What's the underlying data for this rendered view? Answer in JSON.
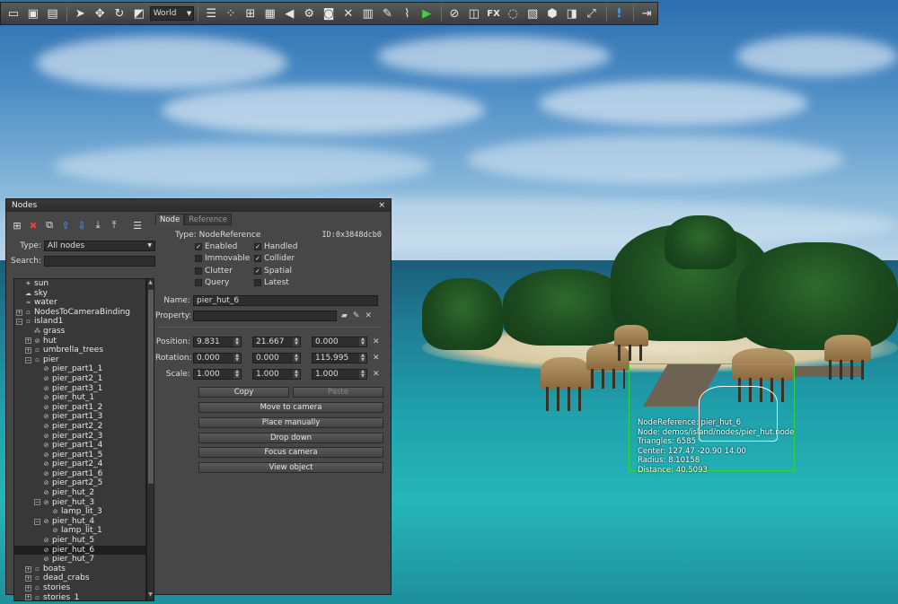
{
  "toolbar": {
    "coord_space": "World",
    "fx_label": "FX",
    "icons": [
      "new-icon",
      "open-icon",
      "save-icon",
      "pointer-icon",
      "move-icon",
      "rotate-icon",
      "scale-icon",
      "nodes-list-icon",
      "materials-icon",
      "grid-icon",
      "render-icon",
      "sound-icon",
      "physics-icon",
      "camera-icon",
      "tools-icon",
      "editor-icon",
      "script-icon",
      "profiler-icon",
      "play-icon",
      "link-icon",
      "node-icon",
      "light-icon",
      "texture-icon",
      "mesh-icon",
      "world-icon",
      "expand-icon",
      "warning-icon",
      "exit-icon"
    ]
  },
  "nodes_window": {
    "title": "Nodes",
    "close": "×",
    "type_label": "Type:",
    "type_value": "All nodes",
    "search_label": "Search:",
    "search_value": "",
    "tree": [
      {
        "label": "sun",
        "indent": 0,
        "expander": "",
        "icon": "sun-icon"
      },
      {
        "label": "sky",
        "indent": 0,
        "expander": "",
        "icon": "sky-icon"
      },
      {
        "label": "water",
        "indent": 0,
        "expander": "",
        "icon": "water-icon"
      },
      {
        "label": "NodesToCameraBinding",
        "indent": 0,
        "expander": "+",
        "icon": "node-icon"
      },
      {
        "label": "island1",
        "indent": 0,
        "expander": "−",
        "icon": "node-icon"
      },
      {
        "label": "grass",
        "indent": 1,
        "expander": "",
        "icon": "grass-icon"
      },
      {
        "label": "hut",
        "indent": 1,
        "expander": "+",
        "icon": "reference-icon"
      },
      {
        "label": "umbrella_trees",
        "indent": 1,
        "expander": "+",
        "icon": "node-icon"
      },
      {
        "label": "pier",
        "indent": 1,
        "expander": "−",
        "icon": "node-icon"
      },
      {
        "label": "pier_part1_1",
        "indent": 2,
        "expander": "",
        "icon": "reference-icon"
      },
      {
        "label": "pier_part2_1",
        "indent": 2,
        "expander": "",
        "icon": "reference-icon"
      },
      {
        "label": "pier_part3_1",
        "indent": 2,
        "expander": "",
        "icon": "reference-icon"
      },
      {
        "label": "pier_hut_1",
        "indent": 2,
        "expander": "",
        "icon": "reference-icon"
      },
      {
        "label": "pier_part1_2",
        "indent": 2,
        "expander": "",
        "icon": "reference-icon"
      },
      {
        "label": "pier_part1_3",
        "indent": 2,
        "expander": "",
        "icon": "reference-icon"
      },
      {
        "label": "pier_part2_2",
        "indent": 2,
        "expander": "",
        "icon": "reference-icon"
      },
      {
        "label": "pier_part2_3",
        "indent": 2,
        "expander": "",
        "icon": "reference-icon"
      },
      {
        "label": "pier_part1_4",
        "indent": 2,
        "expander": "",
        "icon": "reference-icon"
      },
      {
        "label": "pier_part1_5",
        "indent": 2,
        "expander": "",
        "icon": "reference-icon"
      },
      {
        "label": "pier_part2_4",
        "indent": 2,
        "expander": "",
        "icon": "reference-icon"
      },
      {
        "label": "pier_part1_6",
        "indent": 2,
        "expander": "",
        "icon": "reference-icon"
      },
      {
        "label": "pier_part2_5",
        "indent": 2,
        "expander": "",
        "icon": "reference-icon"
      },
      {
        "label": "pier_hut_2",
        "indent": 2,
        "expander": "",
        "icon": "reference-icon"
      },
      {
        "label": "pier_hut_3",
        "indent": 2,
        "expander": "−",
        "icon": "reference-icon"
      },
      {
        "label": "lamp_lit_3",
        "indent": 3,
        "expander": "",
        "icon": "reference-icon"
      },
      {
        "label": "pier_hut_4",
        "indent": 2,
        "expander": "−",
        "icon": "reference-icon"
      },
      {
        "label": "lamp_lit_1",
        "indent": 3,
        "expander": "",
        "icon": "reference-icon"
      },
      {
        "label": "pier_hut_5",
        "indent": 2,
        "expander": "",
        "icon": "reference-icon"
      },
      {
        "label": "pier_hut_6",
        "indent": 2,
        "expander": "",
        "icon": "reference-icon",
        "selected": true
      },
      {
        "label": "pier_hut_7",
        "indent": 2,
        "expander": "",
        "icon": "reference-icon"
      },
      {
        "label": "boats",
        "indent": 1,
        "expander": "+",
        "icon": "node-icon"
      },
      {
        "label": "dead_crabs",
        "indent": 1,
        "expander": "+",
        "icon": "node-icon"
      },
      {
        "label": "stories",
        "indent": 1,
        "expander": "+",
        "icon": "node-icon"
      },
      {
        "label": "stories_1",
        "indent": 1,
        "expander": "+",
        "icon": "node-icon"
      }
    ],
    "tabs": [
      "Node",
      "Reference"
    ],
    "type_prefix": "Type:",
    "node_type": "NodeReference",
    "node_id": "ID:0x3848dcb0",
    "flags": [
      {
        "label": "Enabled",
        "checked": true
      },
      {
        "label": "Handled",
        "checked": true
      },
      {
        "label": "Immovable",
        "checked": false
      },
      {
        "label": "Collider",
        "checked": true
      },
      {
        "label": "Clutter",
        "checked": false
      },
      {
        "label": "Spatial",
        "checked": true
      },
      {
        "label": "Query",
        "checked": false
      },
      {
        "label": "Latest",
        "checked": false
      }
    ],
    "name_label": "Name:",
    "name_value": "pier_hut_6",
    "property_label": "Property:",
    "property_value": "",
    "position_label": "Position:",
    "position": [
      "9.831",
      "21.667",
      "0.000"
    ],
    "rotation_label": "Rotation:",
    "rotation": [
      "0.000",
      "0.000",
      "115.995"
    ],
    "scale_label": "Scale:",
    "scale": [
      "1.000",
      "1.000",
      "1.000"
    ],
    "copy_label": "Copy",
    "paste_label": "Paste",
    "actions": [
      "Move to camera",
      "Place manually",
      "Drop down",
      "Focus camera",
      "View object"
    ]
  },
  "viewport_overlay": {
    "lines": [
      "NodeReference: pier_hut_6",
      "Node: demos/island/nodes/pier_hut.node",
      "Triangles: 6585",
      "Center: 127.47 -20.90 14.00",
      "Radius: 8.10158",
      "Distance: 40.5093"
    ]
  },
  "colors": {
    "panel": "#474747",
    "bbox_green": "#31d43a",
    "selection": "#1f1f1f"
  }
}
